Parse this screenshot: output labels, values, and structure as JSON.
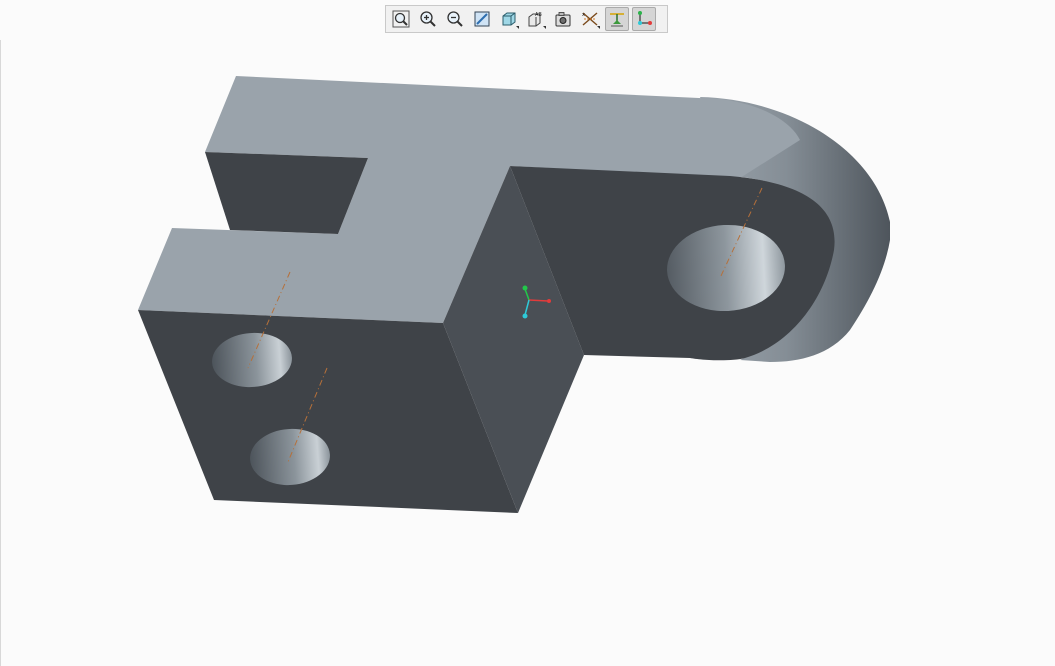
{
  "app": {
    "view_background": "#fbfbfb"
  },
  "toolbar": {
    "buttons": [
      {
        "name": "refit",
        "icon": "zoom-fit-icon",
        "active": false
      },
      {
        "name": "zoom-in",
        "icon": "zoom-in-icon",
        "active": false
      },
      {
        "name": "zoom-out",
        "icon": "zoom-out-icon",
        "active": false
      },
      {
        "name": "repaint",
        "icon": "repaint-icon",
        "active": false
      },
      {
        "name": "display-style",
        "icon": "display-style-icon",
        "active": false,
        "dropdown": true
      },
      {
        "name": "saved-orientations",
        "icon": "saved-views-icon",
        "active": false,
        "dropdown": true
      },
      {
        "name": "view-manager",
        "icon": "view-manager-icon",
        "active": false
      },
      {
        "name": "datum-display",
        "icon": "datum-display-icon",
        "active": false,
        "dropdown": true
      },
      {
        "name": "annotation-display",
        "icon": "annotation-display-icon",
        "active": true
      },
      {
        "name": "spin-center",
        "icon": "spin-center-icon",
        "active": true
      }
    ]
  },
  "model": {
    "colors": {
      "top_face": "#9aa3ab",
      "front_face": "#3f4348",
      "side_face": "#4a4f55",
      "axis_line": "#b5703a",
      "csys_x": "#e23b3b",
      "csys_y": "#22c84a",
      "csys_z": "#2ecad8"
    }
  }
}
